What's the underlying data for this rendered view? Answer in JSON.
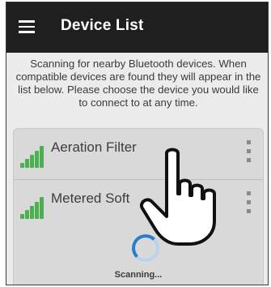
{
  "app": {
    "title": "Device List",
    "menu_icon": "hamburger-menu-icon"
  },
  "description": "Scanning for nearby Bluetooth devices. When compatible devices are found they will appear in the list below. Please choose the device you would like to connect to at any time.",
  "devices": [
    {
      "name": "Aeration Filter",
      "signal_icon": "signal-strength-icon",
      "signal_bars": 5,
      "menu_icon": "more-vertical-icon"
    },
    {
      "name": "Metered Soft",
      "signal_icon": "signal-strength-icon",
      "signal_bars": 5,
      "menu_icon": "more-vertical-icon"
    }
  ],
  "status": {
    "label": "Scanning...",
    "spinner_icon": "loading-spinner-icon"
  },
  "overlay": {
    "icon": "pointing-hand-icon"
  },
  "colors": {
    "appbar": "#1f1f1f",
    "signal": "#4caf50",
    "spinner": "#2b7bd3",
    "card": "#d9d9d9"
  }
}
